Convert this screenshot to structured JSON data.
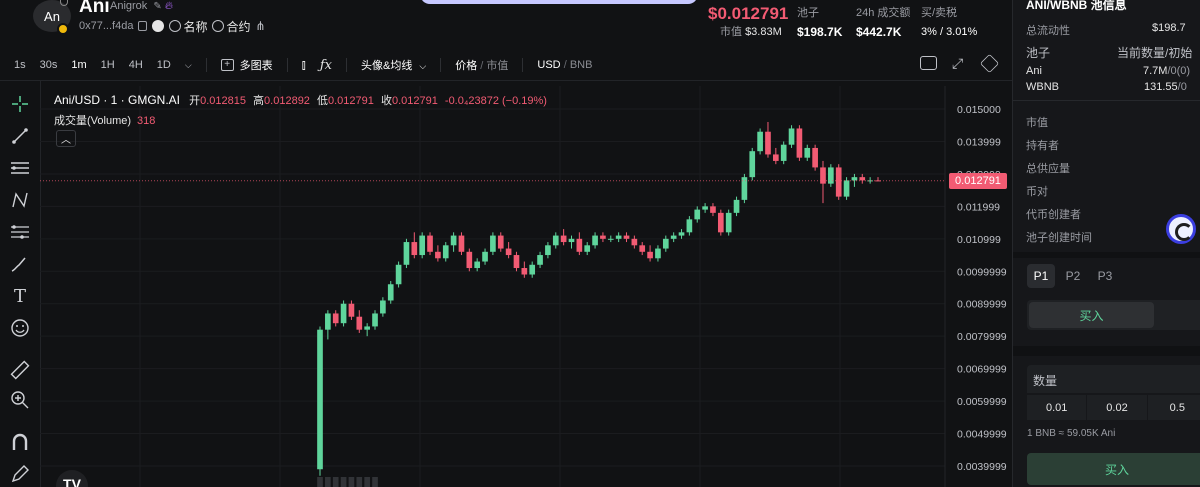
{
  "header": {
    "logo_text": "An",
    "token_name": "Ani",
    "token_full": "Anigrok",
    "address": "0x77...f4da",
    "link_name": "名称",
    "link_contract": "合约",
    "price": "$0.012791",
    "mcap_label": "市值",
    "mcap_value": "$3.83M",
    "stats": [
      {
        "label": "池子",
        "value": "$198.7K"
      },
      {
        "label": "24h 成交额",
        "value": "$442.7K"
      },
      {
        "label": "买/卖税",
        "value": "3% / 3.01%"
      }
    ]
  },
  "toolbar": {
    "timeframes": [
      "1s",
      "30s",
      "1m",
      "1H",
      "4H",
      "1D"
    ],
    "active_timeframe": "1m",
    "multi_chart": "多图表",
    "indicators": "头像&均线",
    "price_label": "价格",
    "mcap_label": "市值",
    "currency_usd": "USD",
    "currency_bnb": "BNB"
  },
  "legend": {
    "title": "Ani/USD · 1 · GMGN.AI",
    "open_label": "开",
    "open": "0.012815",
    "high_label": "高",
    "high": "0.012892",
    "low_label": "低",
    "low": "0.012791",
    "close_label": "收",
    "close": "0.012791",
    "change": "-0.0₄23872 (−0.19%)",
    "volume_label": "成交量(Volume)",
    "volume_value": "318"
  },
  "chart_data": {
    "type": "candlestick",
    "title": "Ani/USD · 1 · GMGN.AI",
    "ylim": [
      0.0035,
      0.0155
    ],
    "y_ticks": [
      "0.015000",
      "0.013999",
      "0.012999",
      "0.011999",
      "0.010999",
      "0.0099999",
      "0.0089999",
      "0.0079999",
      "0.0069999",
      "0.0059999",
      "0.0049999",
      "0.0039999"
    ],
    "last_price_label": "0.012791",
    "last_price": 0.012791,
    "candles": [
      [
        0.0039,
        0.0083,
        0.0037,
        0.0082
      ],
      [
        0.0082,
        0.0088,
        0.0079,
        0.0087
      ],
      [
        0.0087,
        0.0088,
        0.0083,
        0.0084
      ],
      [
        0.0084,
        0.0091,
        0.0083,
        0.009
      ],
      [
        0.009,
        0.0091,
        0.0085,
        0.0086
      ],
      [
        0.0086,
        0.0088,
        0.0081,
        0.0082
      ],
      [
        0.0082,
        0.0084,
        0.008,
        0.0083
      ],
      [
        0.0083,
        0.0088,
        0.0082,
        0.0087
      ],
      [
        0.0087,
        0.0092,
        0.0086,
        0.0091
      ],
      [
        0.0091,
        0.0097,
        0.009,
        0.0096
      ],
      [
        0.0096,
        0.0103,
        0.0095,
        0.0102
      ],
      [
        0.0102,
        0.011,
        0.0101,
        0.0109
      ],
      [
        0.0109,
        0.0112,
        0.0104,
        0.0105
      ],
      [
        0.0105,
        0.0112,
        0.0104,
        0.0111
      ],
      [
        0.0111,
        0.0112,
        0.0105,
        0.0106
      ],
      [
        0.0106,
        0.0108,
        0.0103,
        0.0104
      ],
      [
        0.0104,
        0.0109,
        0.0103,
        0.0108
      ],
      [
        0.0108,
        0.0112,
        0.0106,
        0.0111
      ],
      [
        0.0111,
        0.0112,
        0.0105,
        0.0106
      ],
      [
        0.0106,
        0.0107,
        0.01,
        0.0101
      ],
      [
        0.0101,
        0.0104,
        0.01,
        0.0103
      ],
      [
        0.0103,
        0.0107,
        0.0102,
        0.0106
      ],
      [
        0.0106,
        0.0112,
        0.0105,
        0.0111
      ],
      [
        0.0111,
        0.0112,
        0.0106,
        0.0107
      ],
      [
        0.0107,
        0.0109,
        0.0104,
        0.0105
      ],
      [
        0.0105,
        0.0106,
        0.01,
        0.0101
      ],
      [
        0.0101,
        0.0103,
        0.0098,
        0.0099
      ],
      [
        0.0099,
        0.0103,
        0.0098,
        0.0102
      ],
      [
        0.0102,
        0.0106,
        0.0101,
        0.0105
      ],
      [
        0.0105,
        0.0109,
        0.0104,
        0.0108
      ],
      [
        0.0108,
        0.0112,
        0.0107,
        0.0111
      ],
      [
        0.0111,
        0.0113,
        0.0108,
        0.0109
      ],
      [
        0.0109,
        0.0111,
        0.0107,
        0.011
      ],
      [
        0.011,
        0.0112,
        0.0105,
        0.0106
      ],
      [
        0.0106,
        0.0109,
        0.0105,
        0.0108
      ],
      [
        0.0108,
        0.0112,
        0.0107,
        0.0111
      ],
      [
        0.0111,
        0.0112,
        0.0109,
        0.011
      ],
      [
        0.011,
        0.0111,
        0.0109,
        0.011
      ],
      [
        0.011,
        0.0112,
        0.0109,
        0.0111
      ],
      [
        0.0111,
        0.0112,
        0.0109,
        0.011
      ],
      [
        0.011,
        0.0111,
        0.0107,
        0.0108
      ],
      [
        0.0108,
        0.0109,
        0.0105,
        0.0106
      ],
      [
        0.0106,
        0.0108,
        0.0103,
        0.0104
      ],
      [
        0.0104,
        0.0108,
        0.0103,
        0.0107
      ],
      [
        0.0107,
        0.0111,
        0.0106,
        0.011
      ],
      [
        0.011,
        0.0112,
        0.0109,
        0.0111
      ],
      [
        0.0111,
        0.0113,
        0.011,
        0.0112
      ],
      [
        0.0112,
        0.0117,
        0.0111,
        0.0116
      ],
      [
        0.0116,
        0.012,
        0.0115,
        0.0119
      ],
      [
        0.0119,
        0.0121,
        0.0118,
        0.012
      ],
      [
        0.012,
        0.0121,
        0.0117,
        0.0118
      ],
      [
        0.0118,
        0.0119,
        0.0111,
        0.0112
      ],
      [
        0.0112,
        0.0119,
        0.0111,
        0.0118
      ],
      [
        0.0118,
        0.0123,
        0.0117,
        0.0122
      ],
      [
        0.0122,
        0.013,
        0.0121,
        0.0129
      ],
      [
        0.0129,
        0.0138,
        0.0128,
        0.0137
      ],
      [
        0.0137,
        0.0144,
        0.0136,
        0.0143
      ],
      [
        0.0143,
        0.0146,
        0.0135,
        0.0136
      ],
      [
        0.0136,
        0.0138,
        0.0133,
        0.0134
      ],
      [
        0.0134,
        0.014,
        0.0133,
        0.0139
      ],
      [
        0.0139,
        0.0145,
        0.0138,
        0.0144
      ],
      [
        0.0144,
        0.0145,
        0.0134,
        0.0135
      ],
      [
        0.0135,
        0.0139,
        0.0134,
        0.0138
      ],
      [
        0.0138,
        0.0139,
        0.0131,
        0.0132
      ],
      [
        0.0132,
        0.0134,
        0.0121,
        0.0127
      ],
      [
        0.0127,
        0.0133,
        0.0126,
        0.0132
      ],
      [
        0.0132,
        0.0133,
        0.0122,
        0.0123
      ],
      [
        0.0123,
        0.0129,
        0.0122,
        0.0128
      ],
      [
        0.0128,
        0.013,
        0.0126,
        0.0129
      ],
      [
        0.0129,
        0.013,
        0.0127,
        0.0128
      ],
      [
        0.0128,
        0.0129,
        0.0127,
        0.0128
      ],
      [
        0.0128,
        0.0129,
        0.01279,
        0.012791
      ]
    ],
    "volumes": [
      0,
      0,
      0,
      0,
      0,
      0,
      0,
      0,
      0,
      0,
      0,
      0
    ]
  },
  "left_tools": [
    "crosshair-icon",
    "trendline-icon",
    "fib-icon",
    "pattern-icon",
    "measure-lines-icon",
    "brush-icon",
    "text-icon",
    "emoji-icon",
    "ruler-icon",
    "zoom-icon",
    "magnet-icon",
    "lock-pencil-icon"
  ],
  "right_panel": {
    "title": "ANI/WBNB 池信息",
    "liquidity_label": "总流动性",
    "liquidity_value": "$198.7",
    "pool_col1": "池子",
    "pool_col2": "当前数量/初始",
    "pool_rows": [
      {
        "name": "Ani",
        "amount": "7.7M",
        "rest": "/0(0)"
      },
      {
        "name": "WBNB",
        "amount": "131.55",
        "rest": "/0"
      }
    ],
    "info_rows": [
      "市值",
      "持有者",
      "总供应量",
      "币对",
      "代币创建者",
      "池子创建时间"
    ],
    "presets": [
      "P1",
      "P2",
      "P3"
    ],
    "active_preset": "P1",
    "buy_tab": "买入",
    "qty_label": "数量",
    "qty_options": [
      "0.01",
      "0.02",
      "0.5"
    ],
    "rate": "1 BNB ≈ 59.05K Ani",
    "buy_button": "买入"
  }
}
